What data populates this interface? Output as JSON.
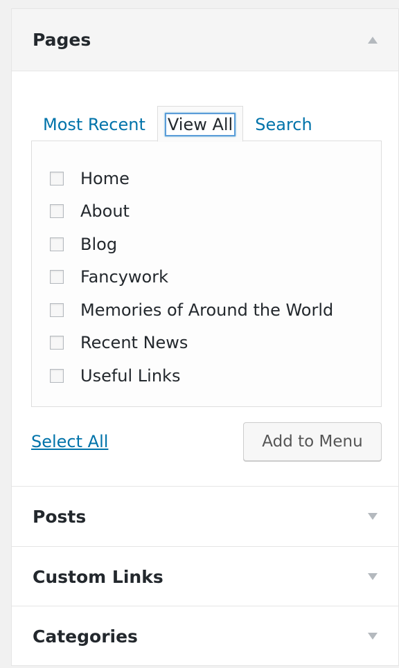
{
  "pages": {
    "title": "Pages",
    "tabs": [
      {
        "label": "Most Recent"
      },
      {
        "label": "View All"
      },
      {
        "label": "Search"
      }
    ],
    "items": [
      {
        "label": "Home",
        "checked": false
      },
      {
        "label": "About",
        "checked": false
      },
      {
        "label": "Blog",
        "checked": false
      },
      {
        "label": "Fancywork",
        "checked": false
      },
      {
        "label": "Memories of Around the World",
        "checked": false
      },
      {
        "label": "Recent News",
        "checked": false
      },
      {
        "label": "Useful Links",
        "checked": false
      }
    ],
    "select_all_label": "Select All",
    "add_button_label": "Add to Menu"
  },
  "sections": [
    {
      "title": "Posts"
    },
    {
      "title": "Custom Links"
    },
    {
      "title": "Categories"
    }
  ],
  "colors": {
    "link": "#0073aa",
    "text": "#23282d",
    "border": "#e5e5e5",
    "arrow": "#b4b9be"
  }
}
